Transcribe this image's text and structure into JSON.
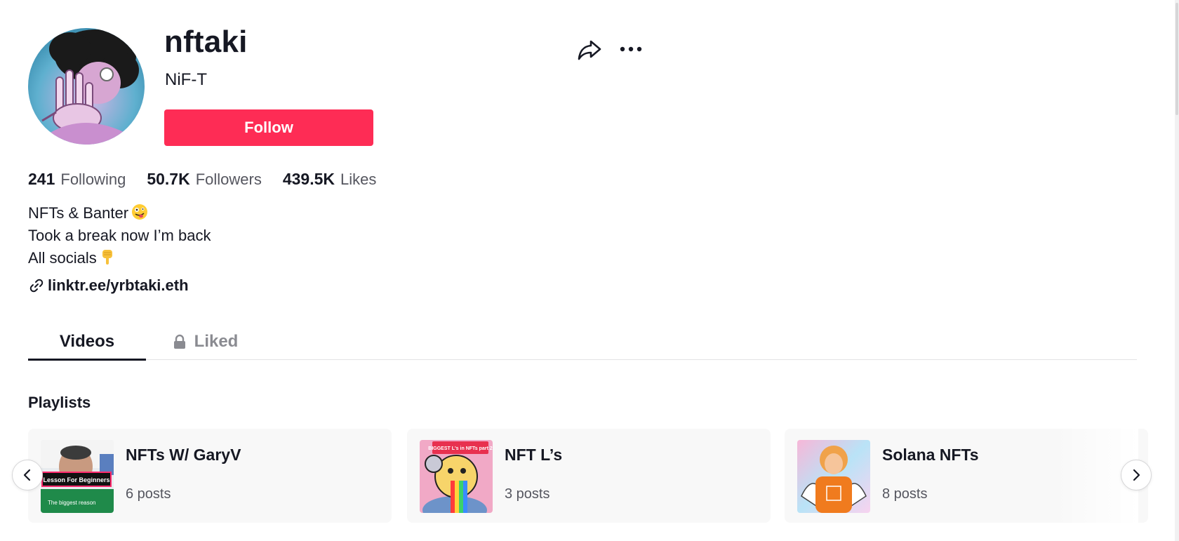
{
  "profile": {
    "username": "nftaki",
    "nickname": "NiF-T",
    "follow_label": "Follow",
    "avatar_icon": "avatar-image",
    "share_icon": "share-icon",
    "more_icon": "more-options-icon"
  },
  "stats": [
    {
      "value": "241",
      "label": "Following"
    },
    {
      "value": "50.7K",
      "label": "Followers"
    },
    {
      "value": "439.5K",
      "label": "Likes"
    }
  ],
  "bio": {
    "line1": "NFTs & Banter",
    "line1_emoji": "zany-face-emoji",
    "line2": "Took a break now I’m back",
    "line3": "All socials",
    "line3_emoji": "pointing-down-emoji"
  },
  "link": {
    "text": "linktr.ee/yrbtaki.eth",
    "icon": "link-icon"
  },
  "tabs": [
    {
      "label": "Videos",
      "active": true
    },
    {
      "label": "Liked",
      "active": false,
      "icon": "lock-icon"
    }
  ],
  "playlists": {
    "title": "Playlists",
    "items": [
      {
        "title": "NFTs W/ GaryV",
        "count": "6 posts",
        "thumb_text": "Lesson For Beginners",
        "thumb_subtext": "The biggest reason"
      },
      {
        "title": "NFT L’s",
        "count": "3 posts",
        "thumb_text": "BIGGEST L's in NFTs part 2"
      },
      {
        "title": "Solana NFTs",
        "count": "8 posts"
      }
    ]
  },
  "colors": {
    "accent": "#fe2c55",
    "text": "#161823",
    "secondary": "#55565f"
  }
}
